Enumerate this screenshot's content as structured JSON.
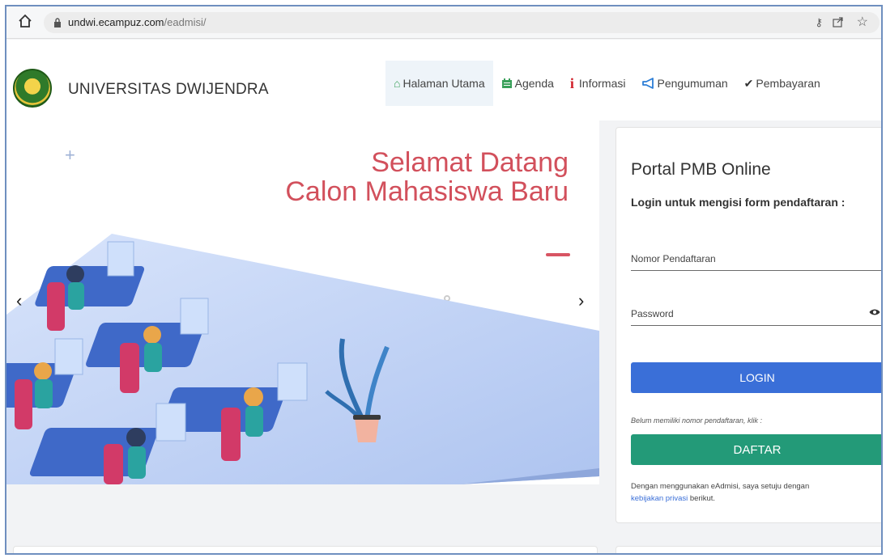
{
  "browser": {
    "url_host": "undwi.ecampuz.com",
    "url_path": "/eadmisi/"
  },
  "header": {
    "brand": "UNIVERSITAS DWIJENDRA",
    "nav": [
      {
        "label": "Halaman Utama",
        "icon": "home-icon"
      },
      {
        "label": "Agenda",
        "icon": "calendar-icon"
      },
      {
        "label": "Informasi",
        "icon": "info-icon"
      },
      {
        "label": "Pengumuman",
        "icon": "bullhorn-icon"
      },
      {
        "label": "Pembayaran",
        "icon": "check-icon"
      }
    ]
  },
  "hero": {
    "title_line1": "Selamat Datang",
    "title_line2": "Calon Mahasiswa Baru",
    "title_color": "#d2505c"
  },
  "login": {
    "title": "Portal PMB Online",
    "subtitle": "Login untuk mengisi form pendaftaran :",
    "registration_placeholder": "Nomor Pendaftaran",
    "password_placeholder": "Password",
    "login_label": "LOGIN",
    "hint": "Belum memiliki nomor pendaftaran, klik :",
    "register_label": "DAFTAR",
    "note_prefix": "Dengan menggunakan eAdmisi, saya setuju dengan",
    "note_link": "kebijakan privasi",
    "note_suffix": "berikut.",
    "login_color": "#3a6fd8",
    "register_color": "#239a78"
  }
}
